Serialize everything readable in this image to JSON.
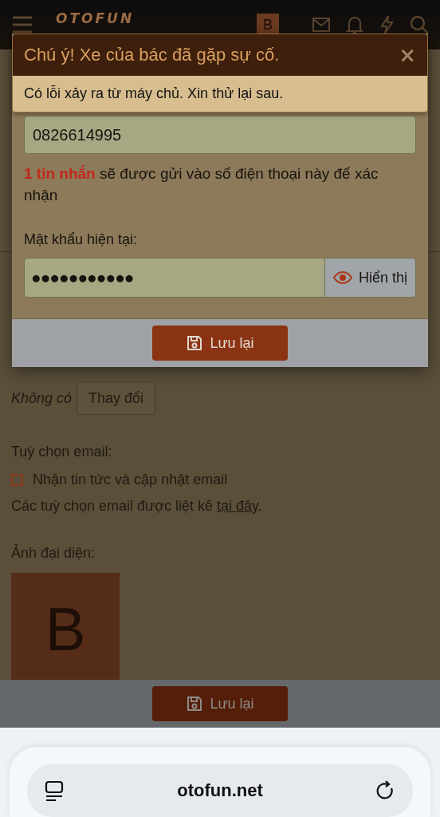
{
  "header": {
    "logo": "OTOFUN",
    "avatar_letter": "B"
  },
  "alert": {
    "title": "Chú ý! Xe của bác đã gặp sự cố.",
    "close": "×",
    "message": "Có lỗi xảy ra từ máy chủ. Xin thử lại sau."
  },
  "modal": {
    "phone_value": "0826614995",
    "sms_note": "**1 tin nhắn** sẽ được gửi vào số điện thoại này để xác nhận",
    "password_label": "Mật khẩu hiện tại:",
    "password_mask": "●●●●●●●●●●●",
    "show_button": "Hiển thị",
    "save_button": "Lưu lại"
  },
  "page": {
    "avatar_value": "Không có",
    "change_button": "Thay đổi",
    "email_label": "Tuỳ chọn email:",
    "email_option": {
      "label": "Nhận tin tức và cập nhật email",
      "checked": false
    },
    "email_note": {
      "text": "Các tuỳ chọn email được liệt kê ",
      "link": "tại đây",
      "end": "."
    },
    "avatar_label": "Ảnh đại diện:",
    "avatar_letter": "B"
  },
  "save_bar": {
    "button": "Lưu lại"
  },
  "browser": {
    "url": "otofun.net"
  }
}
